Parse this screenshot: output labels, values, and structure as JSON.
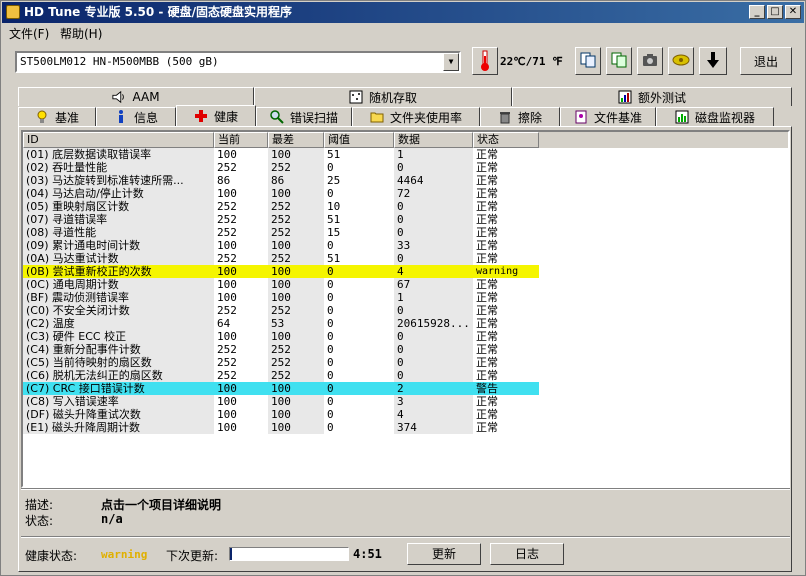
{
  "window": {
    "title": "HD Tune 专业版 5.50 - 硬盘/固态硬盘实用程序",
    "min": "_",
    "max": "□",
    "close": "✕"
  },
  "menu": [
    {
      "label": "文件(F)"
    },
    {
      "label": "帮助(H)"
    }
  ],
  "toolbar": {
    "drive": "ST500LM012 HN-M500MBB (500 gB)",
    "temperature": "22℃/71 ℉",
    "exit_label": "退出",
    "icons": [
      "thermometer-icon",
      "copy-icon",
      "copy-all-icon",
      "camera-icon",
      "health-icon",
      "download-icon"
    ]
  },
  "tabs_top": [
    {
      "label": "AAM",
      "icon": "speaker-icon"
    },
    {
      "label": "随机存取",
      "icon": "random-access-icon"
    },
    {
      "label": "额外测试",
      "icon": "extra-tests-icon"
    }
  ],
  "tabs_bottom": [
    {
      "label": "基准",
      "icon": "benchmark-icon"
    },
    {
      "label": "信息",
      "icon": "info-icon"
    },
    {
      "label": "健康",
      "icon": "health-cross-icon",
      "active": true
    },
    {
      "label": "错误扫描",
      "icon": "magnifier-icon"
    },
    {
      "label": "文件夹使用率",
      "icon": "folder-icon"
    },
    {
      "label": "擦除",
      "icon": "trash-icon"
    },
    {
      "label": "文件基准",
      "icon": "file-benchmark-icon"
    },
    {
      "label": "磁盘监视器",
      "icon": "monitor-icon"
    }
  ],
  "table": {
    "headers": [
      "ID",
      "当前",
      "最差",
      "阈值",
      "数据",
      "状态"
    ],
    "rows": [
      [
        "(01) 底层数据读取错误率",
        "100",
        "100",
        "51",
        "1",
        "正常"
      ],
      [
        "(02) 吞吐量性能",
        "252",
        "252",
        "0",
        "0",
        "正常"
      ],
      [
        "(03) 马达旋转到标准转速所需...",
        "86",
        "86",
        "25",
        "4464",
        "正常"
      ],
      [
        "(04) 马达启动/停止计数",
        "100",
        "100",
        "0",
        "72",
        "正常"
      ],
      [
        "(05) 重映射扇区计数",
        "252",
        "252",
        "10",
        "0",
        "正常"
      ],
      [
        "(07) 寻道错误率",
        "252",
        "252",
        "51",
        "0",
        "正常"
      ],
      [
        "(08) 寻道性能",
        "252",
        "252",
        "15",
        "0",
        "正常"
      ],
      [
        "(09) 累计通电时间计数",
        "100",
        "100",
        "0",
        "33",
        "正常"
      ],
      [
        "(0A) 马达重试计数",
        "252",
        "252",
        "51",
        "0",
        "正常"
      ],
      [
        "(0B) 尝试重新校正的次数",
        "100",
        "100",
        "0",
        "4",
        "warning"
      ],
      [
        "(0C) 通电周期计数",
        "100",
        "100",
        "0",
        "67",
        "正常"
      ],
      [
        "(BF) 震动侦测错误率",
        "100",
        "100",
        "0",
        "1",
        "正常"
      ],
      [
        "(C0) 不安全关闭计数",
        "252",
        "252",
        "0",
        "0",
        "正常"
      ],
      [
        "(C2) 温度",
        "64",
        "53",
        "0",
        "20615928...",
        "正常"
      ],
      [
        "(C3) 硬件 ECC 校正",
        "100",
        "100",
        "0",
        "0",
        "正常"
      ],
      [
        "(C4) 重新分配事件计数",
        "252",
        "252",
        "0",
        "0",
        "正常"
      ],
      [
        "(C5) 当前待映射的扇区数",
        "252",
        "252",
        "0",
        "0",
        "正常"
      ],
      [
        "(C6) 脱机无法纠正的扇区数",
        "252",
        "252",
        "0",
        "0",
        "正常"
      ],
      [
        "(C7) CRC 接口错误计数",
        "100",
        "100",
        "0",
        "2",
        "警告"
      ],
      [
        "(C8) 写入错误速率",
        "100",
        "100",
        "0",
        "3",
        "正常"
      ],
      [
        "(DF) 磁头升降重试次数",
        "100",
        "100",
        "0",
        "4",
        "正常"
      ],
      [
        "(E1) 磁头升降周期计数",
        "100",
        "100",
        "0",
        "374",
        "正常"
      ]
    ],
    "highlight": {
      "9": "#f5f500",
      "18": "#40e0f0"
    }
  },
  "info": {
    "desc_label": "描述:",
    "desc_value": "点击一个项目详细说明",
    "status_label": "状态:",
    "status_value": "n/a"
  },
  "bottom": {
    "health_label": "健康状态:",
    "health_value": "warning",
    "health_color": "#e0b000",
    "next_update_label": "下次更新:",
    "progress": 0.02,
    "countdown": "4:51",
    "refresh_label": "更新",
    "log_label": "日志"
  }
}
